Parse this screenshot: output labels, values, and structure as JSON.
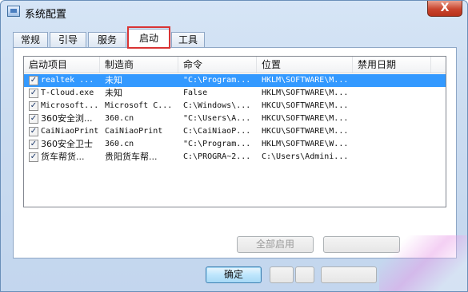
{
  "window": {
    "title": "系统配置",
    "close_glyph": "X"
  },
  "tabs": [
    {
      "label": "常规"
    },
    {
      "label": "引导"
    },
    {
      "label": "服务"
    },
    {
      "label": "启动",
      "active": true
    },
    {
      "label": "工具"
    }
  ],
  "list": {
    "columns": [
      "启动项目",
      "制造商",
      "命令",
      "位置",
      "禁用日期"
    ],
    "rows": [
      {
        "checked": true,
        "selected": true,
        "item": "realtek ...",
        "maker": "未知",
        "command": "\"C:\\Program...",
        "location": "HKLM\\SOFTWARE\\M...",
        "disabled": ""
      },
      {
        "checked": true,
        "selected": false,
        "item": "T-Cloud.exe",
        "maker": "未知",
        "command": "False",
        "location": "HKLM\\SOFTWARE\\M...",
        "disabled": ""
      },
      {
        "checked": true,
        "selected": false,
        "item": "Microsoft...",
        "maker": "Microsoft C...",
        "command": "C:\\Windows\\...",
        "location": "HKCU\\SOFTWARE\\M...",
        "disabled": ""
      },
      {
        "checked": true,
        "selected": false,
        "item": "360安全浏...",
        "maker": "360.cn",
        "command": "\"C:\\Users\\A...",
        "location": "HKCU\\SOFTWARE\\M...",
        "disabled": ""
      },
      {
        "checked": true,
        "selected": false,
        "item": "CaiNiaoPrint",
        "maker": "CaiNiaoPrint",
        "command": "C:\\CaiNiaoP...",
        "location": "HKCU\\SOFTWARE\\M...",
        "disabled": ""
      },
      {
        "checked": true,
        "selected": false,
        "item": "360安全卫士",
        "maker": "360.cn",
        "command": "\"C:\\Program...",
        "location": "HKLM\\SOFTWARE\\W...",
        "disabled": ""
      },
      {
        "checked": true,
        "selected": false,
        "item": "货车帮货...",
        "maker": "贵阳货车帮...",
        "command": "C:\\PROGRA~2...",
        "location": "C:\\Users\\Admini...",
        "disabled": ""
      }
    ]
  },
  "buttons": {
    "enable_all": "全部启用",
    "ok": "确定"
  },
  "colors": {
    "selection": "#3399ff",
    "highlight_box": "#d93434"
  }
}
